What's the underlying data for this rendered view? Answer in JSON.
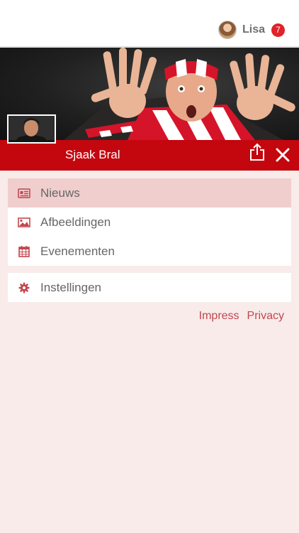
{
  "header": {
    "user_name": "Lisa",
    "notification_count": "7"
  },
  "profile": {
    "name": "Sjaak Bral"
  },
  "menu": {
    "items": [
      {
        "label": "Nieuws",
        "icon": "newspaper-icon",
        "active": true
      },
      {
        "label": "Afbeeldingen",
        "icon": "image-icon",
        "active": false
      },
      {
        "label": "Evenementen",
        "icon": "calendar-icon",
        "active": false
      }
    ],
    "settings": {
      "label": "Instellingen",
      "icon": "gear-icon"
    }
  },
  "footer": {
    "impress": "Impress",
    "privacy": "Privacy"
  },
  "colors": {
    "brand_red": "#c4060e",
    "active_row": "#f0cece",
    "background": "#f8ebea",
    "link": "#c2474c",
    "badge": "#e0222a"
  }
}
